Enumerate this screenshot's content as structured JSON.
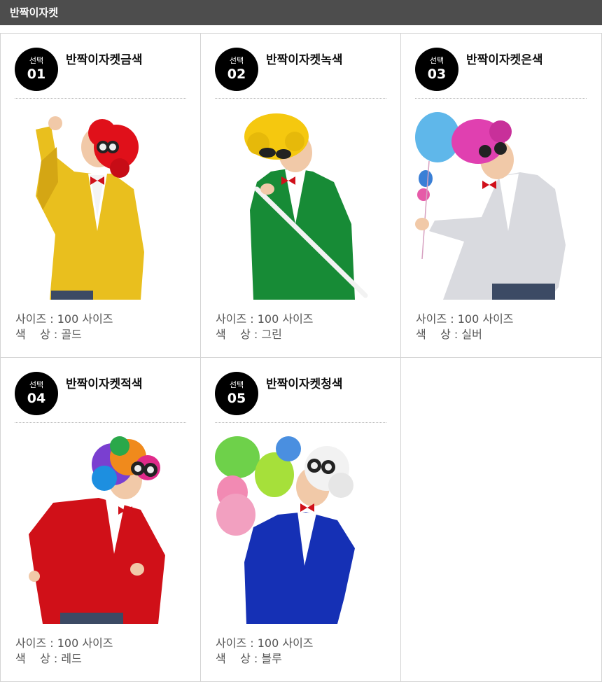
{
  "header": {
    "title": "반짝이자켓"
  },
  "select_label": "선택",
  "size_prefix": "사이즈 : ",
  "color_prefix": "색    상 : ",
  "products": [
    {
      "num": "01",
      "name": "반짝이자켓금색",
      "size": "100 사이즈",
      "color": "골드",
      "jacket_color": "#e9bf1e",
      "wig_color": "#e0101a"
    },
    {
      "num": "02",
      "name": "반짝이자켓녹색",
      "size": "100 사이즈",
      "color": "그린",
      "jacket_color": "#178b36",
      "wig_color": "#f5c80f"
    },
    {
      "num": "03",
      "name": "반짝이자켓은색",
      "size": "100 사이즈",
      "color": "실버",
      "jacket_color": "#d9dadf",
      "wig_color": "#e040b0"
    },
    {
      "num": "04",
      "name": "반짝이자켓적색",
      "size": "100 사이즈",
      "color": "레드",
      "jacket_color": "#d01018",
      "wig_color": "#7a3fd0"
    },
    {
      "num": "05",
      "name": "반짝이자켓청색",
      "size": "100 사이즈",
      "color": "블루",
      "jacket_color": "#1530b5",
      "wig_color": "#f2f2f2"
    }
  ]
}
